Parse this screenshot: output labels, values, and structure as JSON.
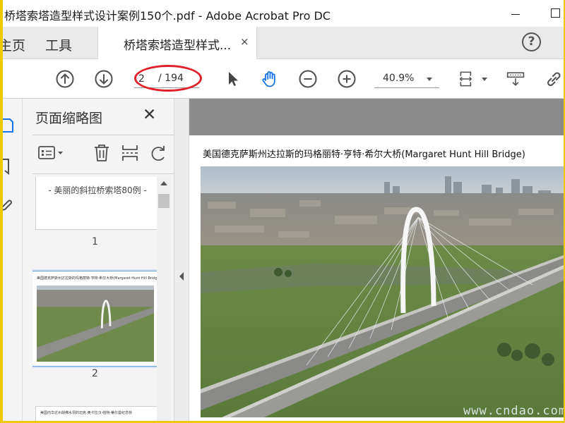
{
  "window": {
    "title": "桥塔索塔造型样式设计案例150个.pdf - Adobe Acrobat Pro DC"
  },
  "tabbar": {
    "home_label": "主页",
    "tools_label": "工具",
    "doc_tab_label": "桥塔索塔造型样式...",
    "doc_tab_close": "×",
    "help_symbol": "?"
  },
  "toolbar": {
    "page_current": "2",
    "page_total": "/ 194",
    "zoom_value": "40.9%",
    "highlight_color": "#e0202a",
    "active_tool_color": "#1473e6",
    "icons": [
      "arrow-up-circle-icon",
      "arrow-down-circle-icon",
      "select-cursor-icon",
      "hand-icon",
      "zoom-out-icon",
      "zoom-in-icon",
      "page-fit-icon",
      "scroll-mode-icon",
      "link-icon"
    ]
  },
  "left_rail": {
    "icons": [
      "page-thumbnails-icon",
      "bookmark-icon",
      "attachment-icon"
    ]
  },
  "thumbnail_panel": {
    "title": "页面缩略图",
    "close_symbol": "✕",
    "tools": [
      "thumbnail-options-icon",
      "delete-page-icon",
      "extract-page-icon",
      "rotate-page-icon"
    ],
    "thumbnails": [
      {
        "page_number": "1",
        "text": "- 美丽的斜拉桥索塔80例 -"
      },
      {
        "page_number": "2",
        "caption": "美国德克萨斯州达拉斯的玛格丽特·亨特·希尔大桥(Margaret Hunt Hill Bridge)",
        "selected": true
      },
      {
        "caption": "美国内华达州胡佛水坝的迈克·奥卡拉汉-帕特·蒂尔曼纪念桥"
      }
    ]
  },
  "document": {
    "caption": "美国德克萨斯州达拉斯的玛格丽特·亨特·希尔大桥(Margaret Hunt Hill Bridge)",
    "watermark": "www.cndao.com"
  }
}
